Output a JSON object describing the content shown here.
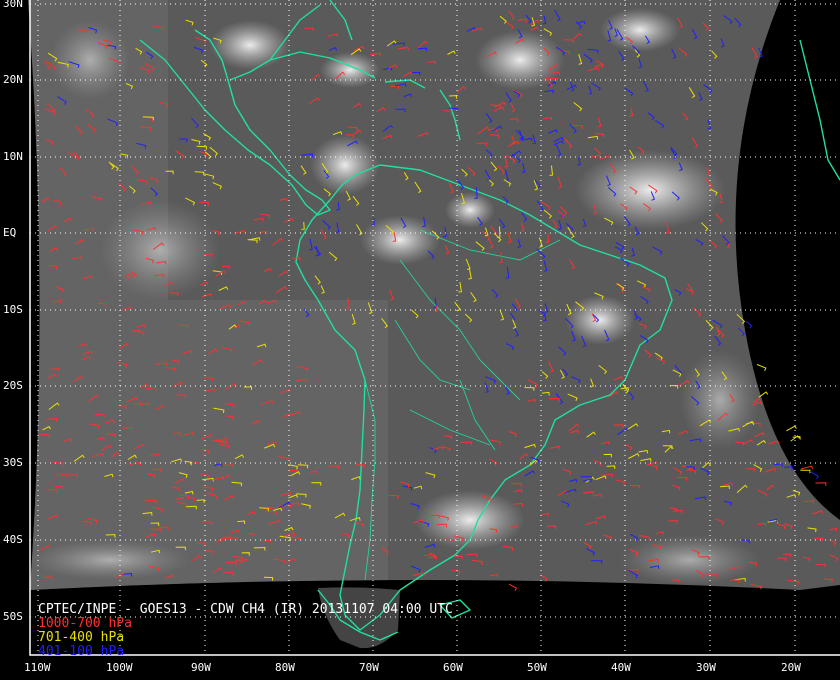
{
  "map": {
    "title": "CPTEC/INPE - GOES13 - CDW CH4 (IR) 20131107 04:00 UTC",
    "latitude_labels": [
      "30N",
      "20N",
      "10N",
      "EQ",
      "10S",
      "20S",
      "30S",
      "40S",
      "50S"
    ],
    "longitude_labels": [
      "110W",
      "100W",
      "90W",
      "80W",
      "70W",
      "60W",
      "50W",
      "40W",
      "30W",
      "20W"
    ],
    "legend": [
      {
        "label": "1000-700 hPa",
        "color": "#ff3030"
      },
      {
        "label": "701-400 hPa",
        "color": "#e8e000"
      },
      {
        "label": "401-100 hPa",
        "color": "#2020ff"
      }
    ],
    "coastline_color": "#20e0a0",
    "grid_color": "#ffffff",
    "background_color": "#000000"
  }
}
